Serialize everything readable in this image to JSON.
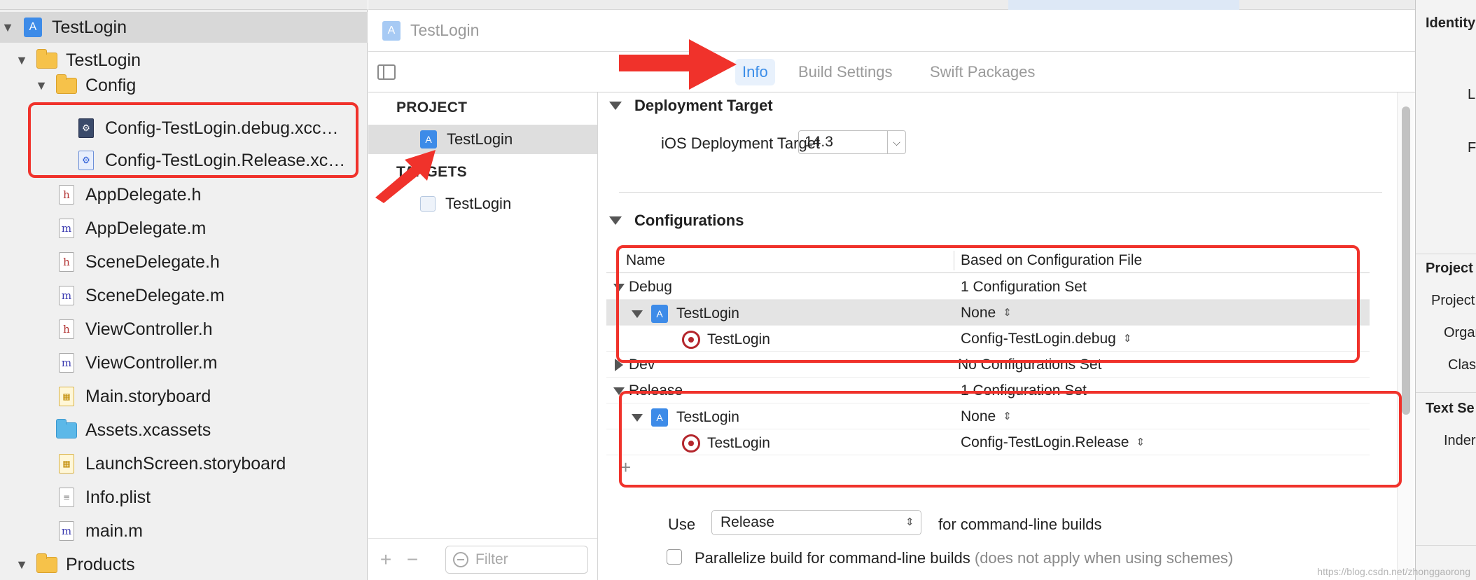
{
  "navigator": {
    "items": [
      {
        "label": "TestLogin",
        "kind": "project",
        "level": 0,
        "expanded": true,
        "selected": true
      },
      {
        "label": "TestLogin",
        "kind": "folder",
        "level": 1,
        "expanded": true
      },
      {
        "label": "Config",
        "kind": "folder",
        "level": 2,
        "expanded": true
      },
      {
        "label": "Config-TestLogin.debug.xcc…",
        "kind": "xcconfig",
        "level": 3
      },
      {
        "label": "Config-TestLogin.Release.xc…",
        "kind": "xcconfig",
        "level": 3
      },
      {
        "label": "AppDelegate.h",
        "kind": "header",
        "level": 2
      },
      {
        "label": "AppDelegate.m",
        "kind": "source",
        "level": 2
      },
      {
        "label": "SceneDelegate.h",
        "kind": "header",
        "level": 2
      },
      {
        "label": "SceneDelegate.m",
        "kind": "source",
        "level": 2
      },
      {
        "label": "ViewController.h",
        "kind": "header",
        "level": 2
      },
      {
        "label": "ViewController.m",
        "kind": "source",
        "level": 2
      },
      {
        "label": "Main.storyboard",
        "kind": "storyboard",
        "level": 2
      },
      {
        "label": "Assets.xcassets",
        "kind": "assets",
        "level": 2
      },
      {
        "label": "LaunchScreen.storyboard",
        "kind": "storyboard",
        "level": 2
      },
      {
        "label": "Info.plist",
        "kind": "plist",
        "level": 2
      },
      {
        "label": "main.m",
        "kind": "source",
        "level": 2
      },
      {
        "label": "Products",
        "kind": "folder",
        "level": 1,
        "expanded": true
      }
    ]
  },
  "jumpbar": {
    "title": "TestLogin"
  },
  "tabs": {
    "info": "Info",
    "build_settings": "Build Settings",
    "swift_packages": "Swift Packages",
    "active": "Info"
  },
  "targets_list": {
    "project_header": "PROJECT",
    "project_item": "TestLogin",
    "targets_header": "TARGETS",
    "target_item": "TestLogin",
    "filter_placeholder": "Filter"
  },
  "deployment": {
    "section_title": "Deployment Target",
    "label": "iOS Deployment Target",
    "value": "14.3"
  },
  "configurations": {
    "section_title": "Configurations",
    "col_name": "Name",
    "col_file": "Based on Configuration File",
    "rows": [
      {
        "name": "Debug",
        "value": "1 Configuration Set"
      },
      {
        "name": "TestLogin",
        "value": "None"
      },
      {
        "name": "TestLogin",
        "value": "Config-TestLogin.debug"
      },
      {
        "name": "Dev",
        "value": "No Configurations Set"
      },
      {
        "name": "Release",
        "value": "1 Configuration Set"
      },
      {
        "name": "TestLogin",
        "value": "None"
      },
      {
        "name": "TestLogin",
        "value": "Config-TestLogin.Release"
      }
    ],
    "use_label": "Use",
    "use_value": "Release",
    "use_tail": "for command-line builds",
    "parallelize_label": "Parallelize build for command-line builds",
    "parallelize_note": "(does not apply when using schemes)"
  },
  "inspector": {
    "identity": "Identity",
    "l": "L",
    "f": "F",
    "project": "Project",
    "project2": "Project",
    "organ": "Organ",
    "class": "Clas",
    "text_settings": "Text Se",
    "indent": "Inder"
  },
  "watermark": "https://blog.csdn.net/zhonggaorong",
  "colors": {
    "accent": "#3b8de8",
    "annotation": "#f0322b",
    "target_red": "#b4262c"
  }
}
